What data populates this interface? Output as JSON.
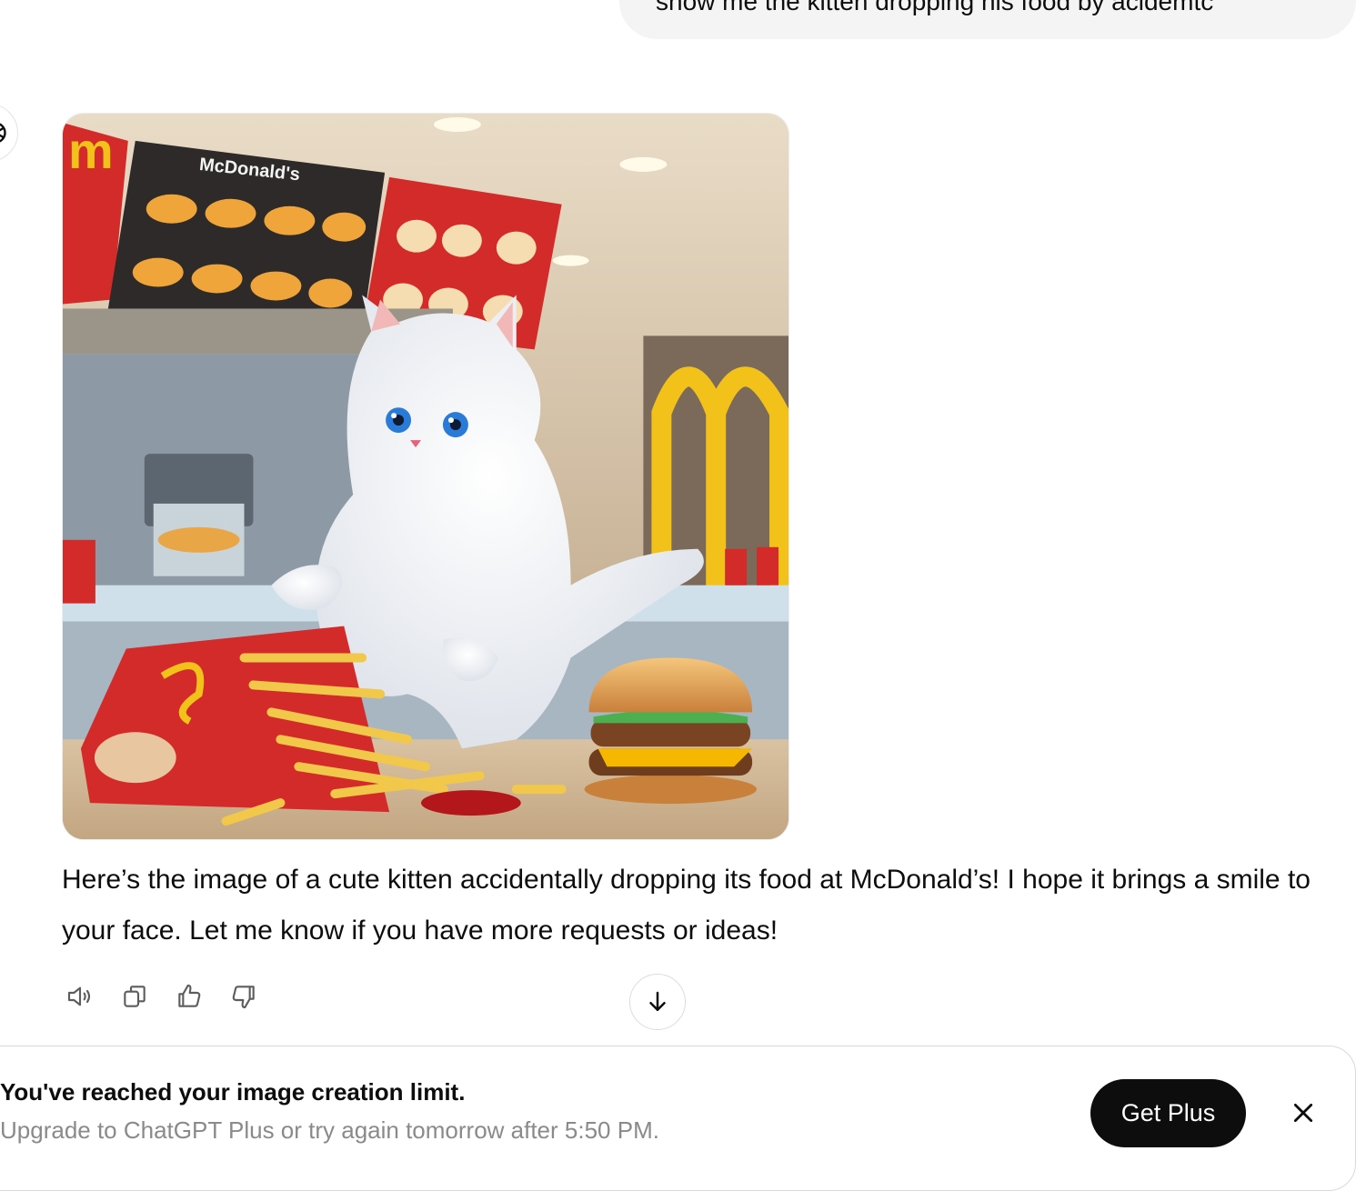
{
  "user_message": {
    "text": "show me the kitten dropping his food by acidemtc"
  },
  "assistant": {
    "image": {
      "alt": "Generated image: a white kitten at a McDonald's counter knocking over fries next to a burger",
      "menu_brand_text": "McDonald's",
      "colors": {
        "menu_red": "#d32a2a",
        "arch_yellow": "#f2c21b",
        "kitten": "#f7f7f7",
        "eyes": "#2a7bd8"
      }
    },
    "reply_text": "Here’s the image of a cute kitten accidentally dropping its food at McDonald’s! I hope it brings a smile to your face. Let me know if you have more requests or ideas!",
    "actions": [
      {
        "icon": "speaker-icon",
        "name": "read-aloud-button"
      },
      {
        "icon": "copy-icon",
        "name": "copy-button"
      },
      {
        "icon": "thumbs-up-icon",
        "name": "good-response-button"
      },
      {
        "icon": "thumbs-down-icon",
        "name": "bad-response-button"
      }
    ]
  },
  "scroll_down": {
    "icon": "arrow-down-icon"
  },
  "limit_banner": {
    "title": "You've reached your image creation limit.",
    "subtitle": "Upgrade to ChatGPT Plus or try again tomorrow after 5:50 PM.",
    "cta_label": "Get Plus",
    "close_icon": "close-icon"
  }
}
